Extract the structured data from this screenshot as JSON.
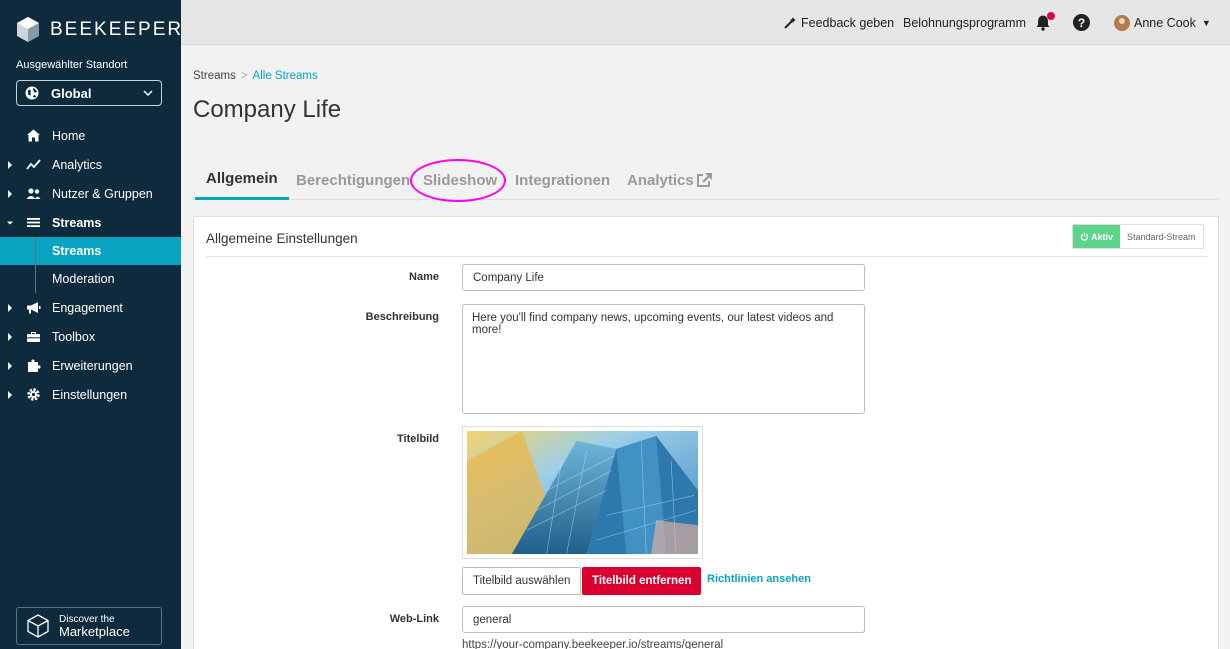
{
  "sidebar": {
    "brand": "BEEKEEPER",
    "location_label": "Ausgewählter Standort",
    "location_value": "Global",
    "nav": [
      {
        "label": "Home",
        "icon": "home-icon"
      },
      {
        "label": "Analytics",
        "icon": "analytics-icon"
      },
      {
        "label": "Nutzer & Gruppen",
        "icon": "users-icon"
      },
      {
        "label": "Streams",
        "icon": "streams-icon"
      },
      {
        "label": "Engagement",
        "icon": "megaphone-icon"
      },
      {
        "label": "Toolbox",
        "icon": "toolbox-icon"
      },
      {
        "label": "Erweiterungen",
        "icon": "puzzle-icon"
      },
      {
        "label": "Einstellungen",
        "icon": "gear-icon"
      }
    ],
    "sub_items": [
      {
        "label": "Streams"
      },
      {
        "label": "Moderation"
      }
    ],
    "marketplace_line1": "Discover the",
    "marketplace_line2": "Marketplace"
  },
  "topbar": {
    "feedback": "Feedback geben",
    "reward": "Belohnungsprogramm",
    "help": "?",
    "user": "Anne Cook"
  },
  "breadcrumb": {
    "root": "Streams",
    "separator": ">",
    "current": "Alle Streams"
  },
  "page_title": "Company Life",
  "tabs": [
    {
      "label": "Allgemein"
    },
    {
      "label": "Berechtigungen"
    },
    {
      "label": "Slideshow"
    },
    {
      "label": "Integrationen"
    },
    {
      "label": "Analytics"
    }
  ],
  "card": {
    "title": "Allgemeine Einstellungen",
    "toggle_active": "Aktiv",
    "toggle_default": "Standard-Stream",
    "name_label": "Name",
    "name_value": "Company Life",
    "desc_label": "Beschreibung",
    "desc_value": "Here you'll find company news, upcoming events, our latest videos and more!",
    "cover_label": "Titelbild",
    "btn_choose": "Titelbild auswählen",
    "btn_remove": "Titelbild entfernen",
    "guidelines": "Richtlinien ansehen",
    "weblink_label": "Web-Link",
    "weblink_value": "general",
    "weblink_url": "https://your-company.beekeeper.io/streams/general"
  },
  "colors": {
    "sidebar_bg": "#0e2a3d",
    "accent": "#07a3c0",
    "danger": "#d9002e",
    "active_green": "#5ed38a",
    "highlight": "#ff00ee"
  }
}
